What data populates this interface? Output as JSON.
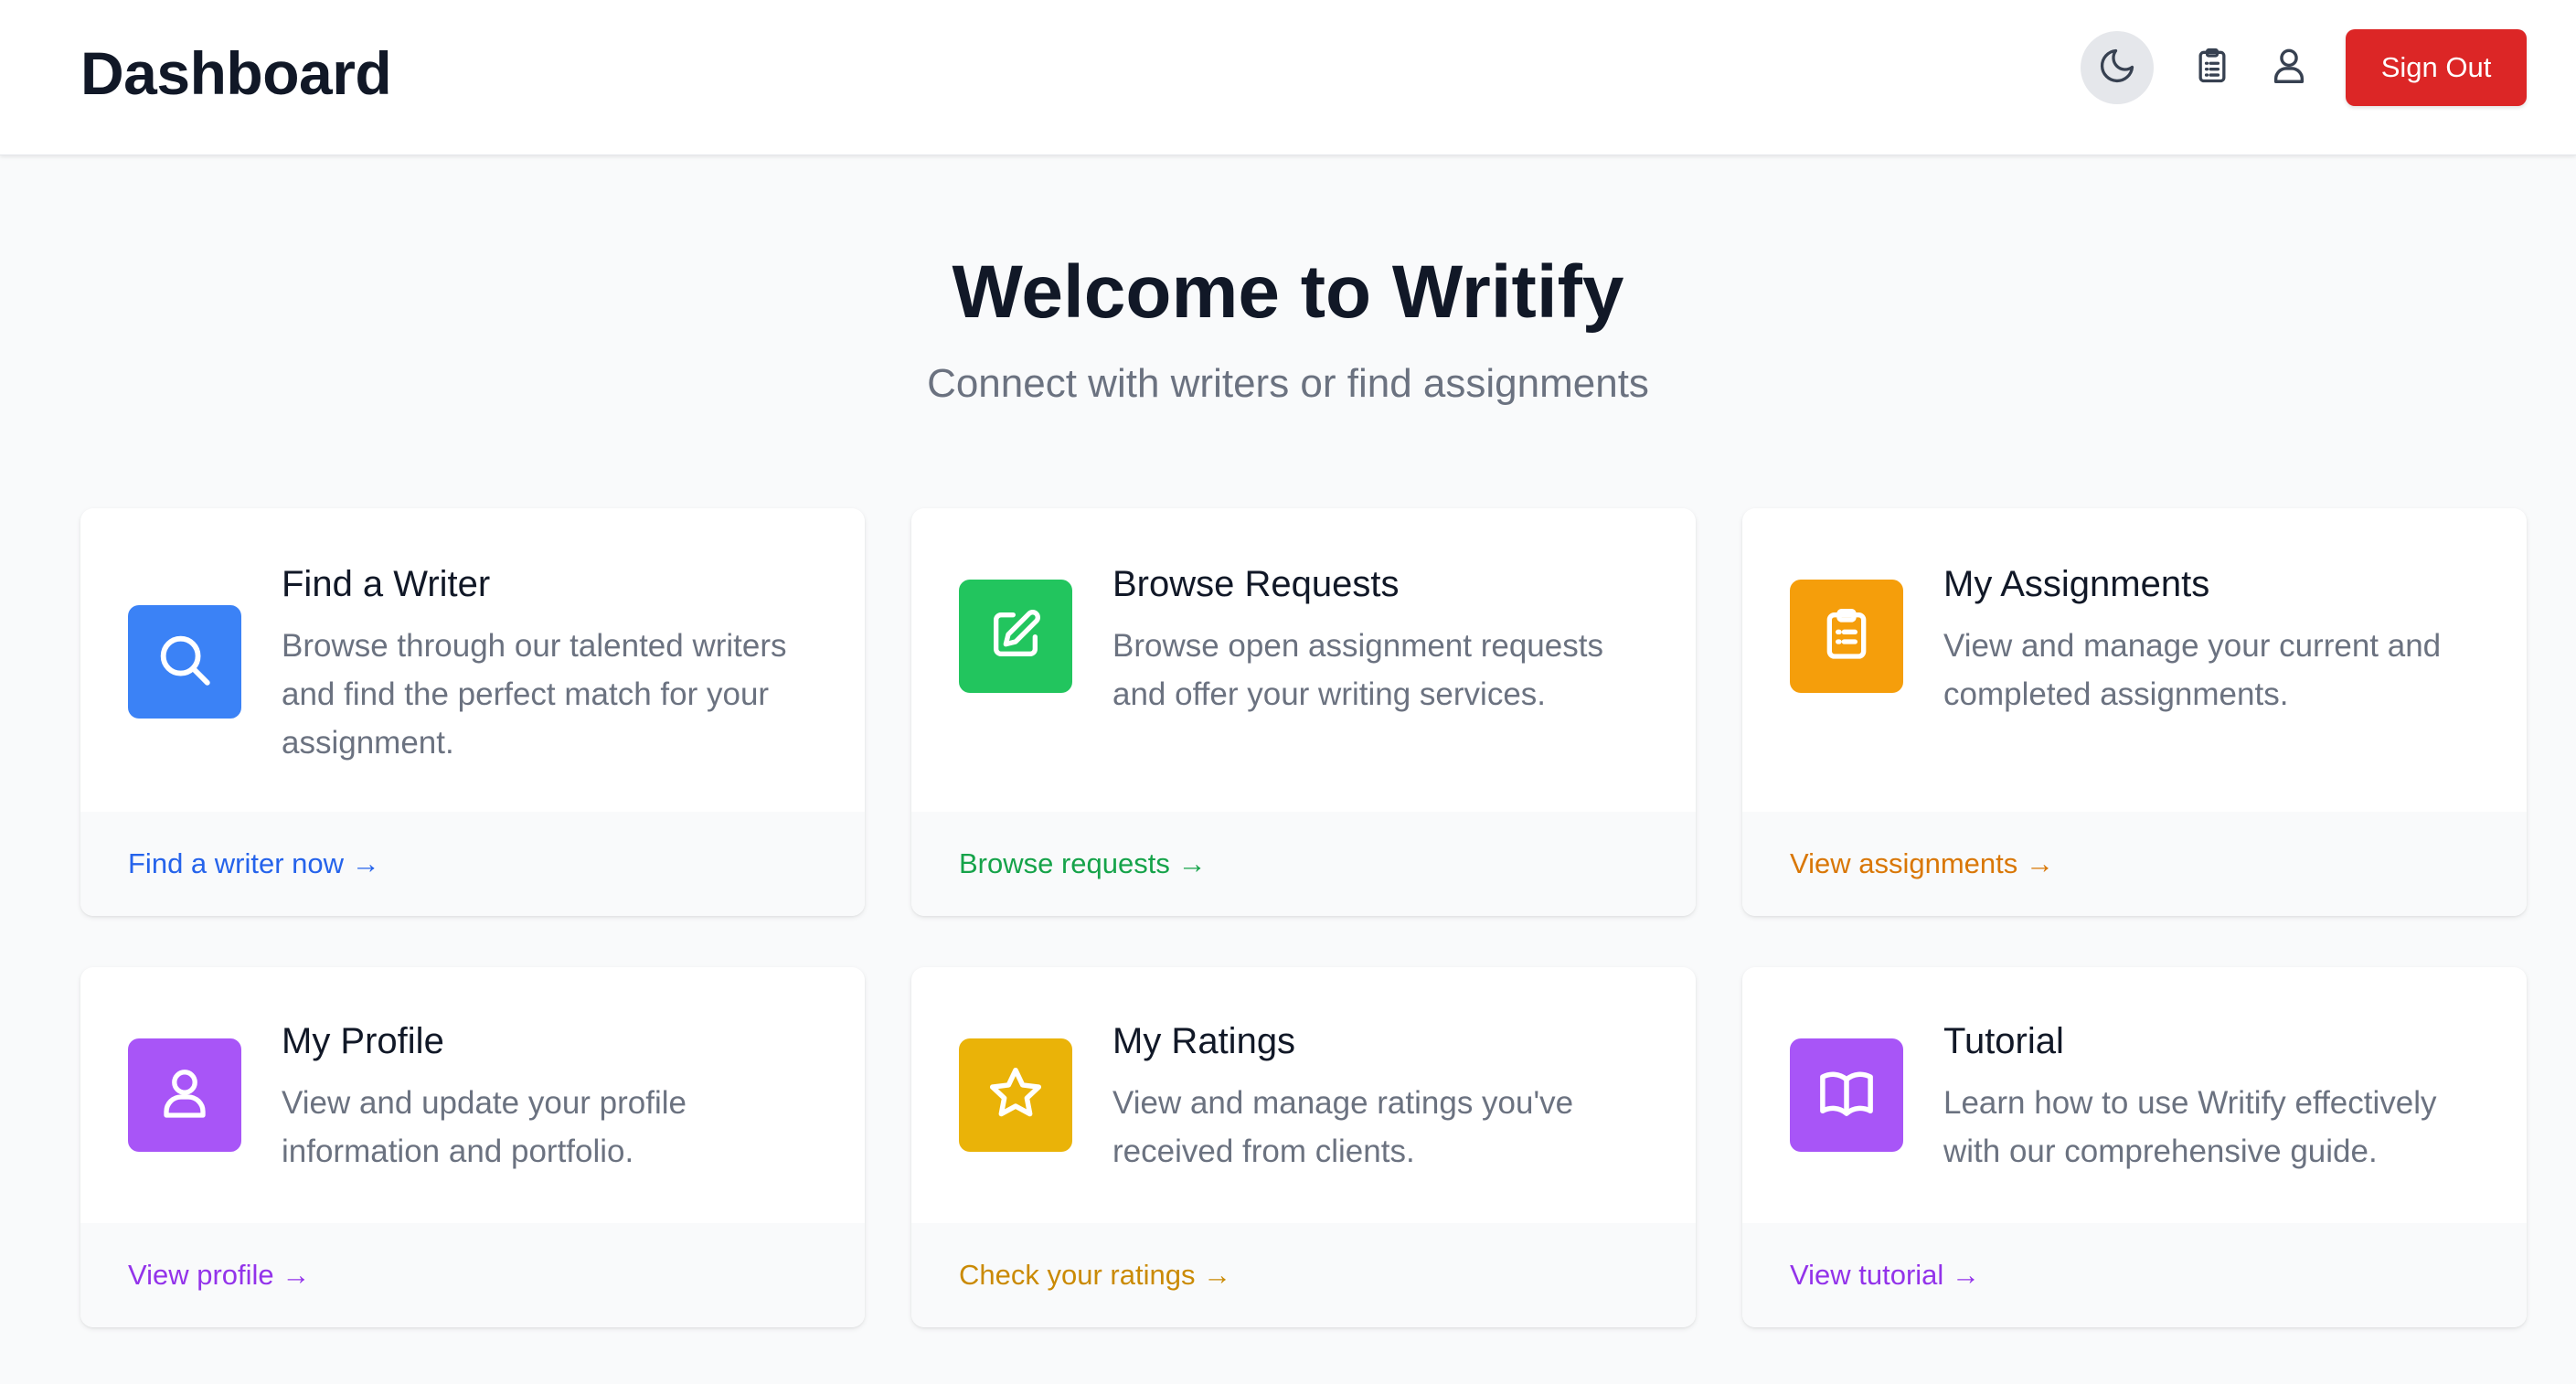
{
  "header": {
    "title": "Dashboard",
    "theme_icon": "moon-icon",
    "assignments_icon": "clipboard-icon",
    "profile_icon": "user-icon",
    "signout_label": "Sign Out"
  },
  "hero": {
    "title": "Welcome to Writify",
    "subtitle": "Connect with writers or find assignments"
  },
  "cards": [
    {
      "title": "Find a Writer",
      "description": "Browse through our talented writers and find the perfect match for your assignment.",
      "link": "Find a writer now →",
      "icon": "search-icon",
      "color": "#3b82f6",
      "link_color": "#2563eb"
    },
    {
      "title": "Browse Requests",
      "description": "Browse open assignment requests and offer your writing services.",
      "link": "Browse requests →",
      "icon": "edit-icon",
      "color": "#22c55e",
      "link_color": "#16a34a"
    },
    {
      "title": "My Assignments",
      "description": "View and manage your current and completed assignments.",
      "link": "View assignments →",
      "icon": "clipboard-icon",
      "color": "#f59e0b",
      "link_color": "#d97706"
    },
    {
      "title": "My Profile",
      "description": "View and update your profile information and portfolio.",
      "link": "View profile →",
      "icon": "user-icon",
      "color": "#a855f7",
      "link_color": "#9333ea"
    },
    {
      "title": "My Ratings",
      "description": "View and manage ratings you've received from clients.",
      "link": "Check your ratings →",
      "icon": "star-icon",
      "color": "#eab308",
      "link_color": "#ca8a04"
    },
    {
      "title": "Tutorial",
      "description": "Learn how to use Writify effectively with our comprehensive guide.",
      "link": "View tutorial →",
      "icon": "book-icon",
      "color": "#a855f7",
      "link_color": "#9333ea"
    }
  ]
}
